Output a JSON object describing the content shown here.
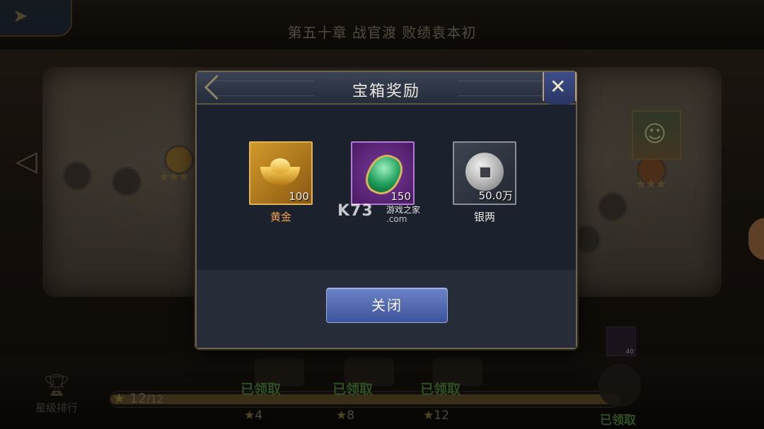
{
  "background": {
    "chapter_title": "第五十章 战官渡 败绩袁本初",
    "rank_label": "星级排行",
    "stars_collected": "12",
    "stars_total": "/12",
    "milestones": [
      {
        "status": "已领取",
        "stars": "4"
      },
      {
        "status": "已领取",
        "stars": "8"
      },
      {
        "status": "已领取",
        "stars": "12"
      }
    ],
    "final_chest_status": "已领取",
    "bag_item_badge": "40"
  },
  "modal": {
    "title": "宝箱奖励",
    "rewards": [
      {
        "name": "黄金",
        "quantity": "100",
        "icon": "gold-ingot-icon",
        "name_color": "#f0a04b"
      },
      {
        "name": "",
        "quantity": "150",
        "icon": "jade-icon",
        "name_color": "#b47ad8"
      },
      {
        "name": "银两",
        "quantity": "50.0万",
        "icon": "silver-coin-icon",
        "name_color": "#e8e6e0"
      }
    ],
    "close_button": "关闭",
    "watermark": {
      "brand": "K73",
      "subtitle": "游戏之家",
      "domain": ".com"
    }
  },
  "colors": {
    "modal_bg": "#1c222d",
    "button_blue": "#4e64ad",
    "claimed_green": "#3e6a2e"
  }
}
